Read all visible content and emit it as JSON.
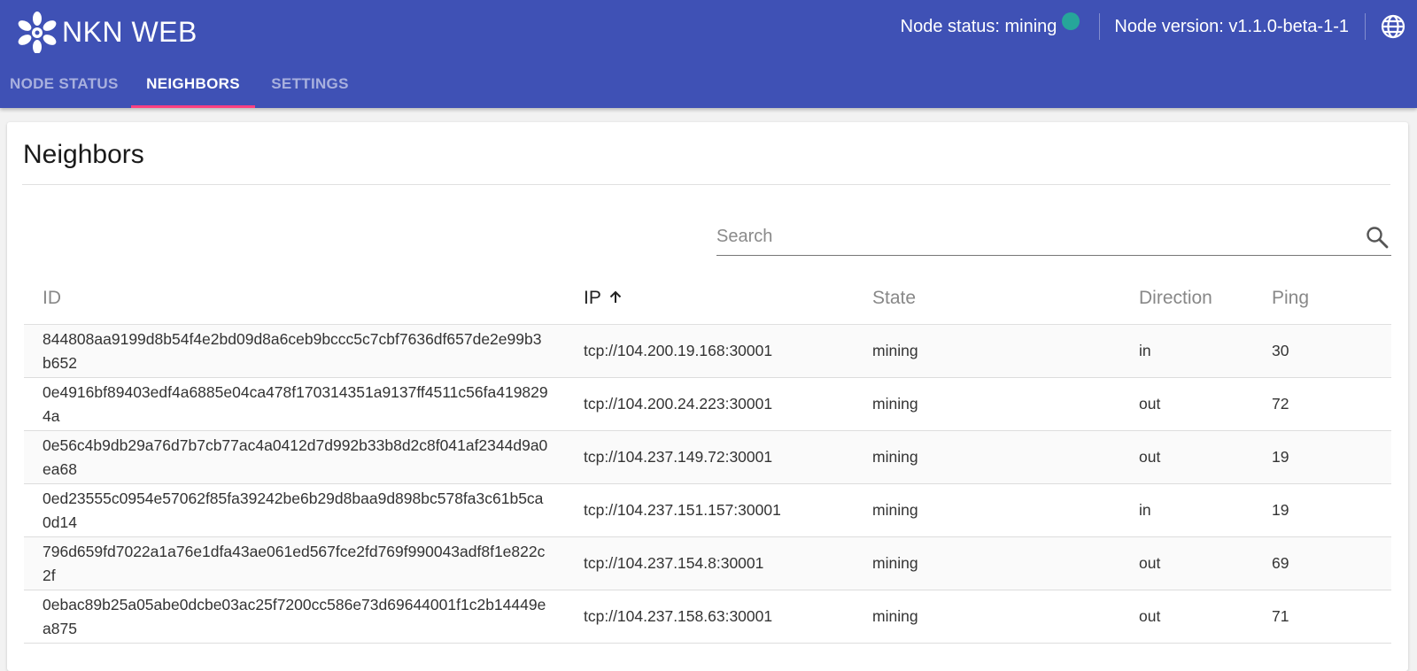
{
  "app": {
    "title": "NKN WEB",
    "status_label": "Node status: mining",
    "status_color": "#26a69a",
    "version_label": "Node version: v1.1.0-beta-1-1",
    "language_icon": "globe-icon"
  },
  "tabs": [
    {
      "label": "NODE STATUS",
      "active": false
    },
    {
      "label": "NEIGHBORS",
      "active": true
    },
    {
      "label": "SETTINGS",
      "active": false
    }
  ],
  "colors": {
    "primary": "#3f51b5",
    "accent": "#ff4081"
  },
  "page": {
    "title": "Neighbors",
    "search_placeholder": "Search",
    "search_icon": "search-icon"
  },
  "table": {
    "columns": [
      "ID",
      "IP",
      "State",
      "Direction",
      "Ping"
    ],
    "sort": {
      "column": "IP",
      "direction": "asc"
    },
    "rows": [
      {
        "id": "844808aa9199d8b54f4e2bd09d8a6ceb9bccc5c7cbf7636df657de2e99b3b652",
        "ip": "tcp://104.200.19.168:30001",
        "state": "mining",
        "direction": "in",
        "ping": "30"
      },
      {
        "id": "0e4916bf89403edf4a6885e04ca478f170314351a9137ff4511c56fa4198294a",
        "ip": "tcp://104.200.24.223:30001",
        "state": "mining",
        "direction": "out",
        "ping": "72"
      },
      {
        "id": "0e56c4b9db29a76d7b7cb77ac4a0412d7d992b33b8d2c8f041af2344d9a0ea68",
        "ip": "tcp://104.237.149.72:30001",
        "state": "mining",
        "direction": "out",
        "ping": "19"
      },
      {
        "id": "0ed23555c0954e57062f85fa39242be6b29d8baa9d898bc578fa3c61b5ca0d14",
        "ip": "tcp://104.237.151.157:30001",
        "state": "mining",
        "direction": "in",
        "ping": "19"
      },
      {
        "id": "796d659fd7022a1a76e1dfa43ae061ed567fce2fd769f990043adf8f1e822c2f",
        "ip": "tcp://104.237.154.8:30001",
        "state": "mining",
        "direction": "out",
        "ping": "69"
      },
      {
        "id": "0ebac89b25a05abe0dcbe03ac25f7200cc586e73d69644001f1c2b14449ea875",
        "ip": "tcp://104.237.158.63:30001",
        "state": "mining",
        "direction": "out",
        "ping": "71"
      }
    ]
  }
}
